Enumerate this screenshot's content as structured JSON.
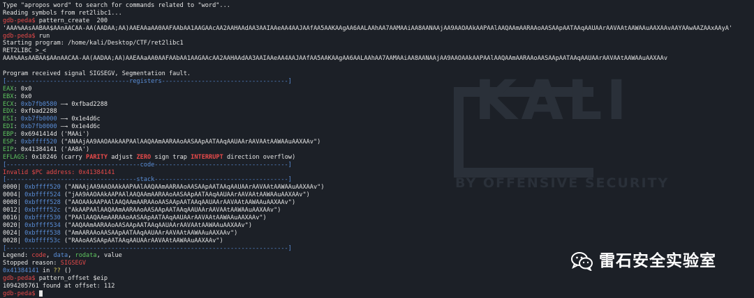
{
  "terminal": {
    "line_apropos": "Type \"apropos word\" to search for commands related to \"word\"...",
    "line_reading": "Reading symbols from ret2libc1...",
    "prompt": "gdb-peda$",
    "cmd_pattern_create": " pattern_create  200",
    "pattern_output": "'AAA%AAsAABAA$AAnAACAA-AA(AADAA;AA)AAEAAaAA0AAFAAbAA1AAGAAcAA2AAHAAdAA3AAIAAeAA4AAJAAfAA5AAKAAgAA6AALAAhAA7AAMAAiAA8AANAAjAA9AAOAAkAAPAAlAAQAAmAARAAoAASAApAATAAqAAUAArAAVAAtAAWAAuAAXAAvAAYAAwAAZAAxAAyA'",
    "cmd_run": " run",
    "starting": "Starting program: /home/kali/Desktop/CTF/ret2libc1",
    "ret2libc": "RET2LIBC >_<",
    "echo_input": "AAA%AAsAABAA$AAnAACAA-AA(AADAA;AA)AAEAAaAA0AAFAAbAA1AAGAAcAA2AAHAAdAA3AAIAAeAA4AAJAAfAA5AAKAAgAA6AALAAhAA7AAMAAiAA8AANAAjAA9AAOAAkAAPAAlAAQAAmAARAAoAASAApAATAAqAAUAArAAVAAtAAWAAuAAXAAv",
    "signal": "Program received signal SIGSEGV, Segmentation fault.",
    "sep_registers": "[----------------------------------registers-----------------------------------]",
    "registers": [
      {
        "name": "EAX",
        "value": "0x0",
        "arrow": "",
        "target": "",
        "name_color": "green",
        "value_color": "plain"
      },
      {
        "name": "EBX",
        "value": "0x0",
        "arrow": "",
        "target": "",
        "name_color": "green",
        "value_color": "plain"
      },
      {
        "name": "ECX",
        "value": "0xb7fb0580",
        "arrow": " --> ",
        "target": "0xfbad2288",
        "name_color": "green",
        "value_color": "blue"
      },
      {
        "name": "EDX",
        "value": "0xfbad2288",
        "arrow": "",
        "target": "",
        "name_color": "green",
        "value_color": "plain"
      },
      {
        "name": "ESI",
        "value": "0xb7fb0000",
        "arrow": " --> ",
        "target": "0x1e4d6c",
        "name_color": "green",
        "value_color": "blue"
      },
      {
        "name": "EDI",
        "value": "0xb7fb0000",
        "arrow": " --> ",
        "target": "0x1e4d6c",
        "name_color": "green",
        "value_color": "blue"
      },
      {
        "name": "EBP",
        "value": "0x6941414d ('MAAi')",
        "arrow": "",
        "target": "",
        "name_color": "green",
        "value_color": "plain"
      },
      {
        "name": "ESP",
        "value": "0xbffff520",
        "arrow": " ",
        "target": "(\"ANAAjAA9AAOAAkAAPAAlAAQAAmAARAAoAASAApAATAAqAAUAArAAVAAtAAWAAuAAXAAv\")",
        "name_color": "green",
        "value_color": "blue"
      },
      {
        "name": "EIP",
        "value": "0x41384141 ('AA8A')",
        "arrow": "",
        "target": "",
        "name_color": "green",
        "value_color": "plain"
      }
    ],
    "eflags_label": "EFLAGS",
    "eflags_value": ": 0x10246 (",
    "flags": [
      {
        "text": "carry",
        "on": false
      },
      {
        "text": "PARITY",
        "on": true
      },
      {
        "text": "adjust",
        "on": false
      },
      {
        "text": "ZERO",
        "on": true
      },
      {
        "text": "sign",
        "on": false
      },
      {
        "text": "trap",
        "on": false
      },
      {
        "text": "INTERRUPT",
        "on": true
      },
      {
        "text": "direction",
        "on": false
      },
      {
        "text": "overflow",
        "on": false
      }
    ],
    "eflags_close": ")",
    "sep_code": "[-------------------------------------code-------------------------------------]",
    "invalid_pc": "Invalid $PC address: 0x41384141",
    "sep_stack": "[------------------------------------stack-------------------------------------]",
    "stack": [
      {
        "idx": "0000|",
        "addr": "0xbffff520",
        "val": " (\"ANAAjAA9AAOAAkAAPAAlAAQAAmAARAAoAASAApAATAAqAAUAArAAVAAtAAWAAuAAXAAv\")"
      },
      {
        "idx": "0004|",
        "addr": "0xbffff524",
        "val": " (\"jAA9AAOAAkAAPAAlAAQAAmAARAAoAASAApAATAAqAAUAArAAVAAtAAWAAuAAXAAv\")"
      },
      {
        "idx": "0008|",
        "addr": "0xbffff528",
        "val": " (\"AAOAAkAAPAAlAAQAAmAARAAoAASAApAATAAqAAUAArAAVAAtAAWAAuAAXAAv\")"
      },
      {
        "idx": "0012|",
        "addr": "0xbffff52c",
        "val": " (\"AkAAPAAlAAQAAmAARAAoAASAApAATAAqAAUAArAAVAAtAAWAAuAAXAAv\")"
      },
      {
        "idx": "0016|",
        "addr": "0xbffff530",
        "val": " (\"PAAlAAQAAmAARAAoAASAApAATAAqAAUAArAAVAAtAAWAAuAAXAAv\")"
      },
      {
        "idx": "0020|",
        "addr": "0xbffff534",
        "val": " (\"AAQAAmAARAAoAASAApAATAAqAAUAArAAVAAtAAWAAuAAXAAv\")"
      },
      {
        "idx": "0024|",
        "addr": "0xbffff538",
        "val": " (\"AmAARAAoAASAApAATAAqAAUAArAAVAAtAAWAAuAAXAAv\")"
      },
      {
        "idx": "0028|",
        "addr": "0xbffff53c",
        "val": " (\"RAAoAASAApAATAAqAAUAArAAVAAtAAWAAuAAXAAv\")"
      }
    ],
    "sep_end": "[------------------------------------------------------------------------------]",
    "legend_label": "Legend: ",
    "legend_code": "code",
    "legend_data": "data",
    "legend_rodata": "rodata",
    "legend_value": "value",
    "stopped_label": "Stopped reason: ",
    "stopped_value": "SIGSEGV",
    "frame_addr": "0x41384141",
    "frame_in": " in ",
    "frame_sym": "??",
    "frame_args": " ()",
    "cmd_pattern_offset": " pattern_offset $eip",
    "offset_result": "1094205761 found at offset: 112"
  },
  "watermark": {
    "text": "雷石安全实验室",
    "icon": "wechat-icon"
  },
  "wallpaper": {
    "logo_text": "KALI",
    "tagline": "BY OFFENSIVE SECURITY"
  },
  "colors": {
    "background": "#1c2027",
    "prompt": "#e84a4a",
    "register_name": "#5ec45e",
    "pointer": "#5a8ed8",
    "separator": "#5a8ed8"
  }
}
